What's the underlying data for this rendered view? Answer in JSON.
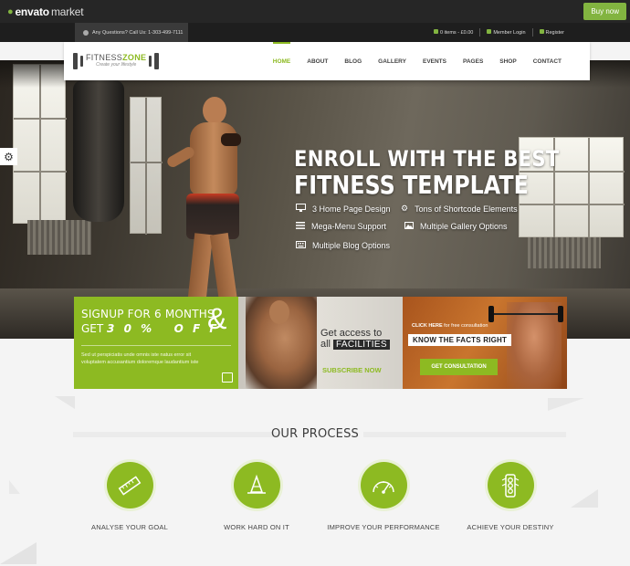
{
  "envato": {
    "logo_main": "envato",
    "logo_sub": "market",
    "buy_label": "Buy now"
  },
  "topbar": {
    "contact": "Any Questions? Call Us: 1-303-499-7111",
    "cart": "0 items - £0.00",
    "login": "Member Login",
    "register": "Register"
  },
  "header": {
    "logo_name_a": "FITNESS",
    "logo_name_b": "ZONE",
    "logo_tagline": "Create your lifestyle",
    "nav": [
      "HOME",
      "ABOUT",
      "BLOG",
      "GALLERY",
      "EVENTS",
      "PAGES",
      "SHOP",
      "CONTACT"
    ],
    "active": "HOME"
  },
  "hero": {
    "title_line1": "ENROLL WITH THE BEST",
    "title_line2": "FITNESS TEMPLATE",
    "features": [
      {
        "label": "3 Home Page Design",
        "icon": "monitor-icon"
      },
      {
        "label": "Tons of Shortcode Elements",
        "icon": "gears-icon"
      },
      {
        "label": "Mega-Menu Support",
        "icon": "menu-icon"
      },
      {
        "label": "Multiple Gallery Options",
        "icon": "image-icon"
      },
      {
        "label": "Multiple Blog Options",
        "icon": "keyboard-icon"
      }
    ]
  },
  "promos": {
    "signup_line1": "SIGNUP FOR 6 MONTHS",
    "signup_get": "GET",
    "signup_off": "3 0 %   O F F",
    "signup_amp": "&",
    "signup_desc": "Sed ut perspiciatis unde omnis iste natus error sit voluptatem accusantium doloremque laudantium iste",
    "access_line1": "Get access to",
    "access_all": "all",
    "access_box": "FACILITIES",
    "subscribe": "SUBSCRIBE NOW",
    "click_here": "CLICK HERE",
    "click_rest": " for free consultation",
    "facts": "KNOW THE FACTS RIGHT",
    "consult": "GET CONSULTATION"
  },
  "process": {
    "title": "OUR PROCESS",
    "steps": [
      {
        "label": "ANALYSE YOUR GOAL",
        "icon": "ruler-icon"
      },
      {
        "label": "WORK HARD ON IT",
        "icon": "cone-icon"
      },
      {
        "label": "IMPROVE YOUR PERFORMANCE",
        "icon": "speedometer-icon"
      },
      {
        "label": "ACHIEVE YOUR DESTINY",
        "icon": "traffic-light-icon"
      }
    ]
  },
  "colors": {
    "accent": "#8dba22",
    "envato_green": "#82b440",
    "dark_bar": "#262626"
  }
}
